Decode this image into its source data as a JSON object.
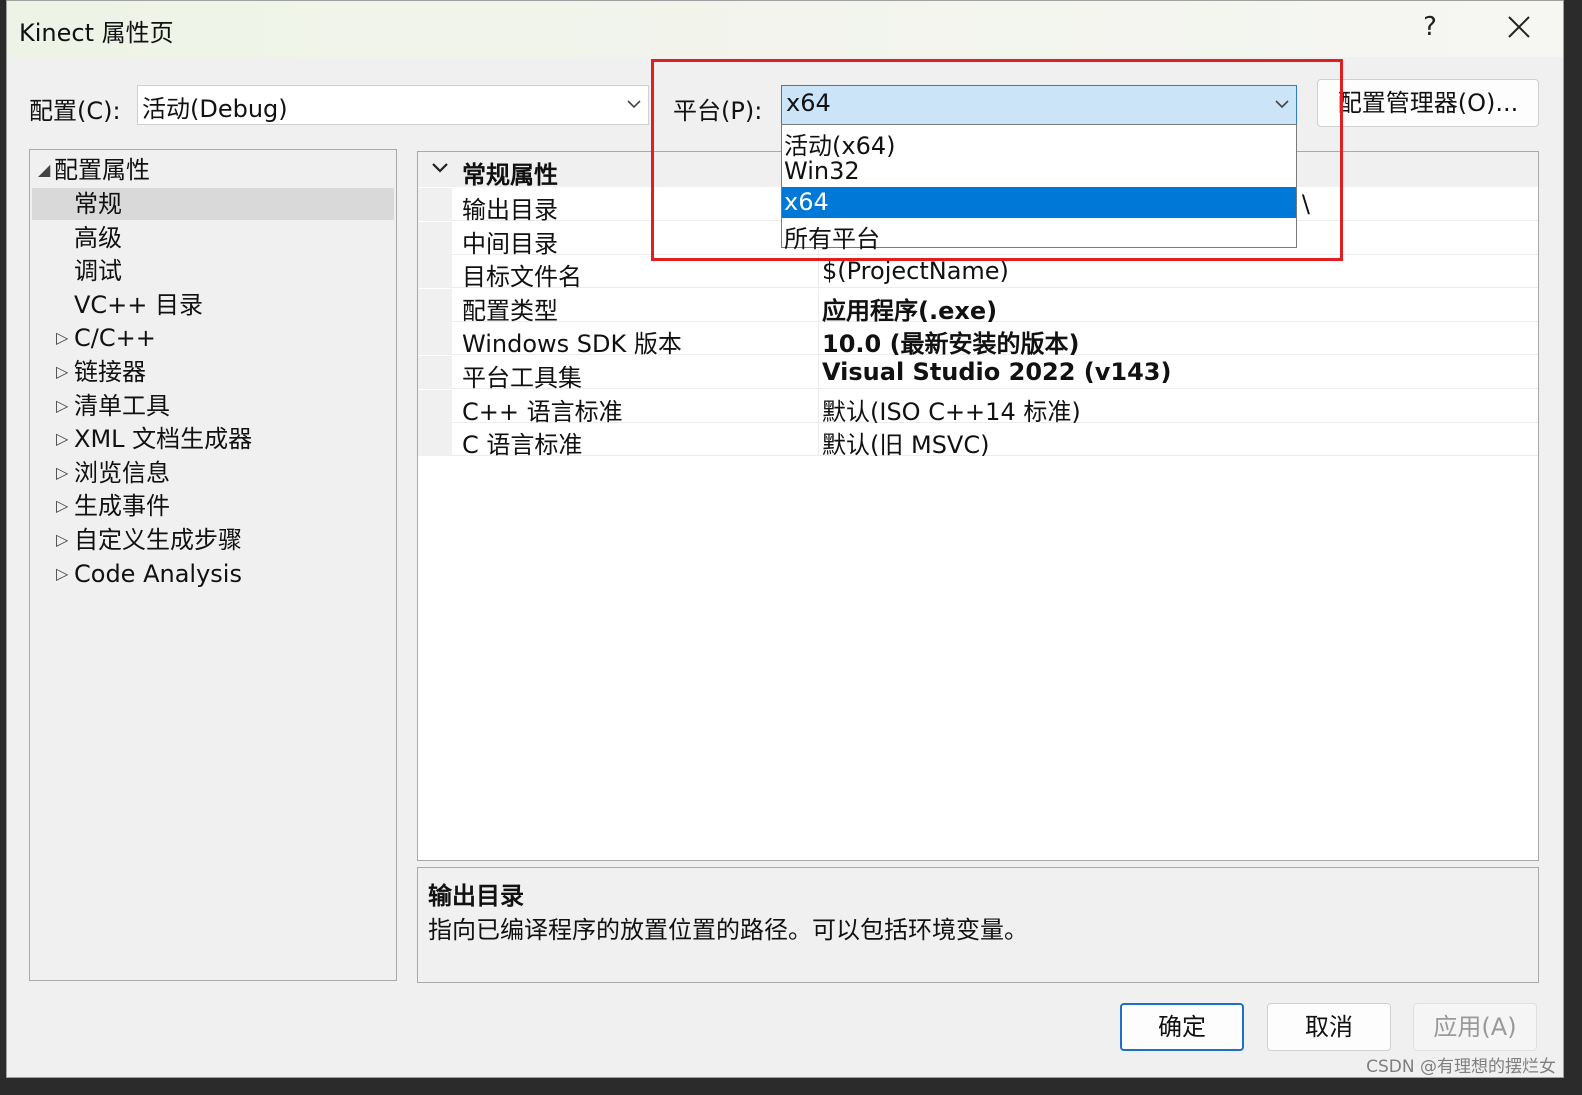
{
  "window": {
    "title": "Kinect 属性页"
  },
  "titlebar": {
    "help_label": "?"
  },
  "config": {
    "label": "配置(C):",
    "value": "活动(Debug)"
  },
  "platform": {
    "label": "平台(P):",
    "value": "x64",
    "options": [
      "活动(x64)",
      "Win32",
      "x64",
      "所有平台"
    ],
    "selected_option": "x64"
  },
  "config_manager": {
    "label": "配置管理器(O)..."
  },
  "tree": {
    "root": "配置属性",
    "items": [
      {
        "label": "常规",
        "expandable": false,
        "selected": true
      },
      {
        "label": "高级",
        "expandable": false
      },
      {
        "label": "调试",
        "expandable": false
      },
      {
        "label": "VC++ 目录",
        "expandable": false
      },
      {
        "label": "C/C++",
        "expandable": true
      },
      {
        "label": "链接器",
        "expandable": true
      },
      {
        "label": "清单工具",
        "expandable": true
      },
      {
        "label": "XML 文档生成器",
        "expandable": true
      },
      {
        "label": "浏览信息",
        "expandable": true
      },
      {
        "label": "生成事件",
        "expandable": true
      },
      {
        "label": "自定义生成步骤",
        "expandable": true
      },
      {
        "label": "Code Analysis",
        "expandable": true
      }
    ]
  },
  "grid": {
    "section": "常规属性",
    "rows": [
      {
        "name": "输出目录",
        "value": "\\",
        "bold": false
      },
      {
        "name": "中间目录",
        "value": "",
        "bold": false
      },
      {
        "name": "目标文件名",
        "value": "$(ProjectName)",
        "bold": false
      },
      {
        "name": "配置类型",
        "value": "应用程序(.exe)",
        "bold": true
      },
      {
        "name": "Windows SDK 版本",
        "value": "10.0 (最新安装的版本)",
        "bold": true
      },
      {
        "name": "平台工具集",
        "value": "Visual Studio 2022 (v143)",
        "bold": true
      },
      {
        "name": "C++ 语言标准",
        "value": "默认(ISO C++14 标准)",
        "bold": false
      },
      {
        "name": "C 语言标准",
        "value": "默认(旧 MSVC)",
        "bold": false
      }
    ]
  },
  "description": {
    "title": "输出目录",
    "text": "指向已编译程序的放置位置的路径。可以包括环境变量。"
  },
  "buttons": {
    "ok": "确定",
    "cancel": "取消",
    "apply": "应用(A)"
  },
  "watermark": "CSDN @有理想的摆烂女",
  "colors": {
    "accent": "#0078d7",
    "highlight_box": "#e02020",
    "focused_combo": "#cce4f7"
  }
}
